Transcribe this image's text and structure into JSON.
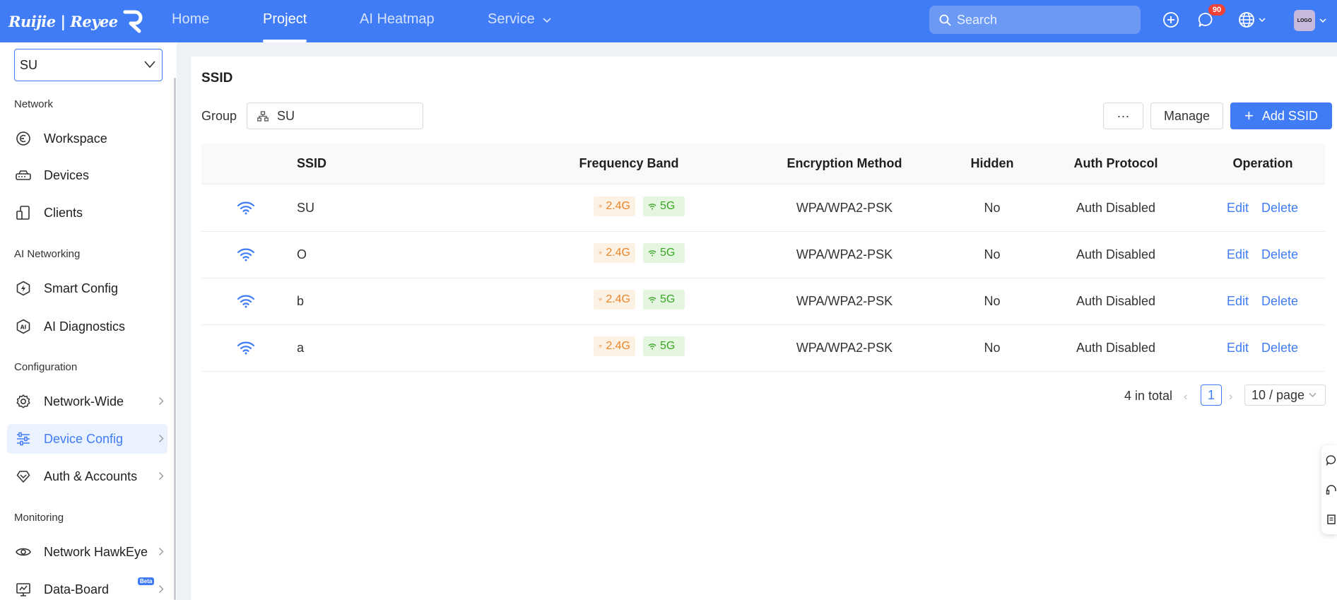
{
  "brand": {
    "name": "Ruijie | Reyee"
  },
  "nav": {
    "items": [
      {
        "label": "Home",
        "active": false
      },
      {
        "label": "Project",
        "active": true
      },
      {
        "label": "AI Heatmap",
        "active": false
      },
      {
        "label": "Service",
        "active": false
      }
    ]
  },
  "topbar": {
    "search_placeholder": "Search",
    "notification_count": "90",
    "avatar_text": "LOGO",
    "accent_color": "#3f7cf6"
  },
  "sidebar": {
    "project": "SU",
    "sections": {
      "network": "Network",
      "ai_networking": "AI Networking",
      "configuration": "Configuration",
      "monitoring": "Monitoring"
    },
    "items": {
      "workspace": "Workspace",
      "devices": "Devices",
      "clients": "Clients",
      "smart_config": "Smart Config",
      "ai_diagnostics": "AI Diagnostics",
      "network_wide": "Network-Wide",
      "device_config": "Device Config",
      "auth_accounts": "Auth & Accounts",
      "network_hawkeye": "Network HawkEye",
      "data_board": "Data-Board"
    },
    "active_item": "Device Config",
    "beta_badge": "Beta"
  },
  "main": {
    "title": "SSID",
    "group_label": "Group",
    "group_value": "SU",
    "buttons": {
      "more": "···",
      "manage": "Manage",
      "add": "Add SSID"
    },
    "columns": {
      "ssid": "SSID",
      "band": "Frequency Band",
      "encryption": "Encryption Method",
      "hidden": "Hidden",
      "auth": "Auth Protocol",
      "operation": "Operation"
    },
    "rows": [
      {
        "ssid": "SU",
        "band_24": "2.4G",
        "band_5": "5G",
        "encryption": "WPA/WPA2-PSK",
        "hidden": "No",
        "auth": "Auth Disabled",
        "edit": "Edit",
        "delete": "Delete"
      },
      {
        "ssid": "O",
        "band_24": "2.4G",
        "band_5": "5G",
        "encryption": "WPA/WPA2-PSK",
        "hidden": "No",
        "auth": "Auth Disabled",
        "edit": "Edit",
        "delete": "Delete"
      },
      {
        "ssid": "b",
        "band_24": "2.4G",
        "band_5": "5G",
        "encryption": "WPA/WPA2-PSK",
        "hidden": "No",
        "auth": "Auth Disabled",
        "edit": "Edit",
        "delete": "Delete"
      },
      {
        "ssid": "a",
        "band_24": "2.4G",
        "band_5": "5G",
        "encryption": "WPA/WPA2-PSK",
        "hidden": "No",
        "auth": "Auth Disabled",
        "edit": "Edit",
        "delete": "Delete"
      }
    ],
    "pagination": {
      "total": "4 in total",
      "current_page": "1",
      "page_size": "10 / page"
    }
  }
}
